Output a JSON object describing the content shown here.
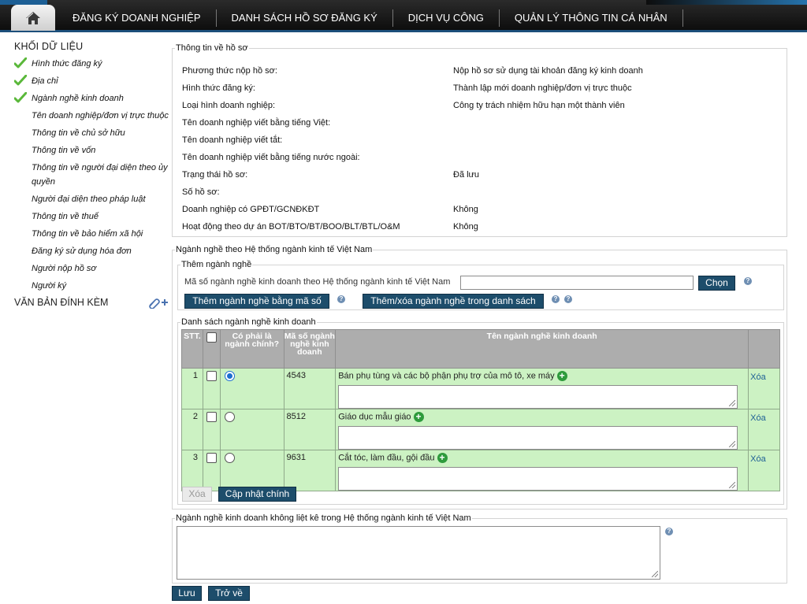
{
  "nav": {
    "items": [
      "ĐĂNG KÝ DOANH NGHIỆP",
      "DANH SÁCH HỒ SƠ ĐĂNG KÝ",
      "DỊCH VỤ CÔNG",
      "QUẢN LÝ THÔNG TIN CÁ NHÂN"
    ]
  },
  "sidebar": {
    "heading": "KHỐI DỮ LIỆU",
    "items": [
      {
        "label": "Hình thức đăng ký",
        "checked": true
      },
      {
        "label": "Địa chỉ",
        "checked": true
      },
      {
        "label": "Ngành nghề kinh doanh",
        "checked": true
      },
      {
        "label": "Tên doanh nghiệp/đơn vị trực thuộc",
        "checked": false
      },
      {
        "label": "Thông tin về chủ sở hữu",
        "checked": false
      },
      {
        "label": "Thông tin về vốn",
        "checked": false
      },
      {
        "label": "Thông tin về người đại diện theo ủy quyền",
        "checked": false
      },
      {
        "label": "Người đại diện theo pháp luật",
        "checked": false
      },
      {
        "label": "Thông tin về thuế",
        "checked": false
      },
      {
        "label": "Thông tin về bảo hiểm xã hội",
        "checked": false
      },
      {
        "label": "Đăng ký sử dụng hóa đơn",
        "checked": false
      },
      {
        "label": "Người nộp hồ sơ",
        "checked": false
      },
      {
        "label": "Người ký",
        "checked": false
      }
    ],
    "attachments_label": "VĂN BẢN ĐÍNH KÈM"
  },
  "info": {
    "legend": "Thông tin về hồ sơ",
    "rows": [
      {
        "label": "Phương thức nộp hồ sơ:",
        "value": "Nộp hồ sơ sử dụng tài khoản đăng ký kinh doanh"
      },
      {
        "label": "Hình thức đăng ký:",
        "value": "Thành lập mới doanh nghiệp/đơn vị trực thuộc"
      },
      {
        "label": "Loại hình doanh nghiệp:",
        "value": "Công ty trách nhiệm hữu hạn một thành viên"
      },
      {
        "label": "Tên doanh nghiệp viết bằng tiếng Việt:",
        "value": ""
      },
      {
        "label": "Tên doanh nghiệp viết tắt:",
        "value": ""
      },
      {
        "label": "Tên doanh nghiệp viết bằng tiếng nước ngoài:",
        "value": ""
      },
      {
        "label": "Trạng thái hồ sơ:",
        "value": "Đã lưu"
      },
      {
        "label": "Số hồ sơ:",
        "value": ""
      },
      {
        "label": "Doanh nghiệp có GPĐT/GCNĐKĐT",
        "value": "Không"
      },
      {
        "label": "Hoạt động theo dự án BOT/BTO/BT/BOO/BLT/BTL/O&M",
        "value": "Không"
      }
    ]
  },
  "industry": {
    "legend": "Ngành nghề theo Hệ thống ngành kinh tế Việt Nam",
    "add_legend": "Thêm ngành nghề",
    "code_label": "Mã số ngành nghề kinh doanh theo Hệ thống ngành kinh tế Việt Nam",
    "code_value": "",
    "choose_button": "Chọn",
    "add_by_code_button": "Thêm ngành nghề bằng mã số",
    "add_remove_list_button": "Thêm/xóa ngành nghề trong danh sách",
    "list_legend": "Danh sách ngành nghề kinh doanh",
    "columns": {
      "stt": "STT.",
      "is_main": "Có phải là ngành chính?",
      "code": "Mã số ngành nghề kinh doanh",
      "name": "Tên ngành nghề kinh doanh"
    },
    "rows": [
      {
        "stt": "1",
        "code": "4543",
        "name": "Bán phụ tùng và các bộ phận phụ trợ của mô tô, xe máy",
        "main": true,
        "delete": "Xóa"
      },
      {
        "stt": "2",
        "code": "8512",
        "name": "Giáo dục mẫu giáo",
        "main": false,
        "delete": "Xóa"
      },
      {
        "stt": "3",
        "code": "9631",
        "name": "Cắt tóc, làm đầu, gội đầu",
        "main": false,
        "delete": "Xóa"
      }
    ],
    "delete_button": "Xóa",
    "update_main_button": "Cập nhật chính"
  },
  "unlisted": {
    "legend": "Ngành nghề kinh doanh không liệt kê trong Hệ thống ngành kinh tế Việt Nam",
    "value": ""
  },
  "footer": {
    "save_button": "Lưu",
    "back_button": "Trở về"
  }
}
